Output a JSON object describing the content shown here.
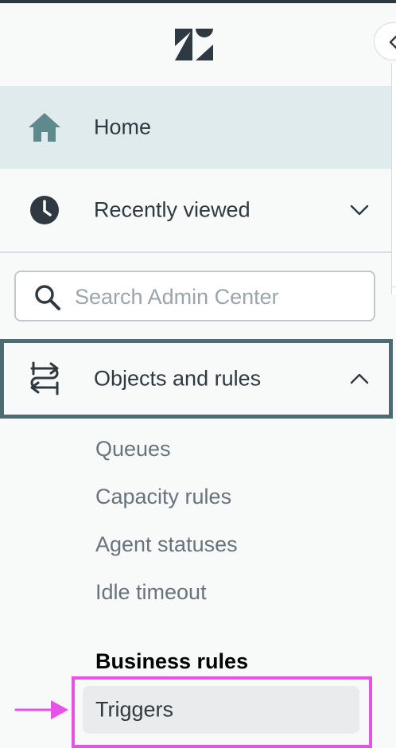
{
  "sidebar": {
    "logo_icon": "zendesk-logo-icon",
    "collapse_icon": "chevron-left-icon",
    "nav": {
      "home": {
        "label": "Home",
        "icon": "home-icon"
      },
      "recent": {
        "label": "Recently viewed",
        "icon": "clock-icon",
        "chevron": "chevron-down-icon"
      }
    },
    "search": {
      "placeholder": "Search Admin Center",
      "value": "",
      "icon": "search-icon"
    },
    "objects_rules": {
      "label": "Objects and rules",
      "icon": "objects-rules-icon",
      "chevron": "chevron-up-icon",
      "subitems": [
        "Queues",
        "Capacity rules",
        "Agent statuses",
        "Idle timeout"
      ],
      "section_title": "Business rules",
      "section_items": [
        "Triggers"
      ]
    }
  },
  "annotation": {
    "highlight_color": "#e651e6",
    "arrow_icon": "arrow-right-icon"
  },
  "colors": {
    "active_bg": "#e0ebed",
    "home_icon": "#5e8a8e",
    "active_border": "#4d6b70",
    "text": "#2f3941",
    "subtext": "#68737d"
  }
}
